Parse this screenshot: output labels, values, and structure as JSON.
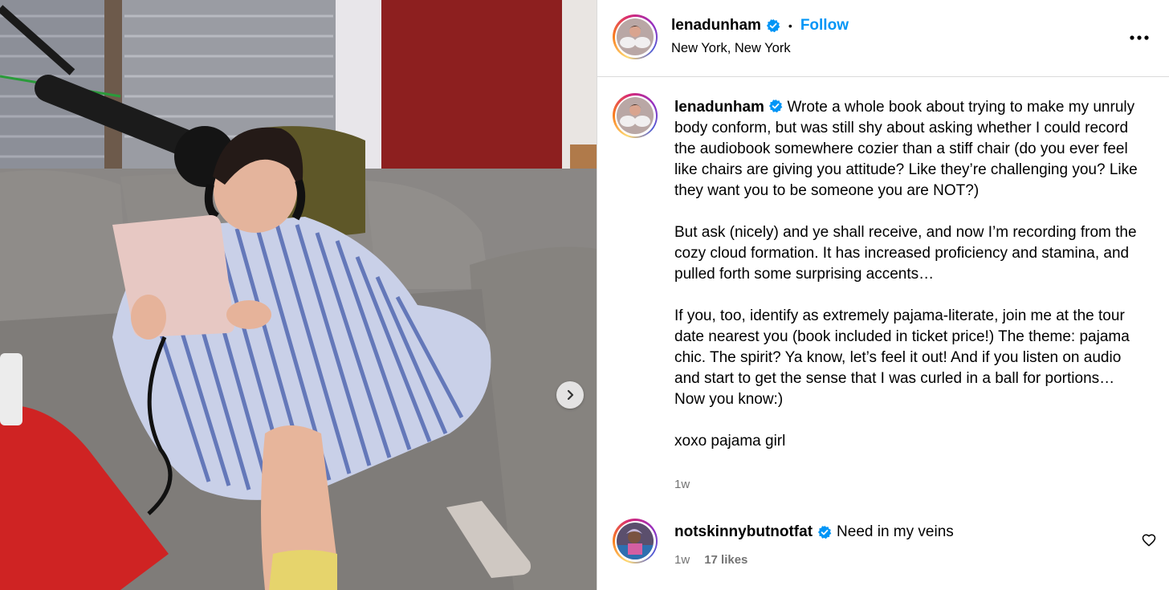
{
  "post": {
    "author": {
      "username": "lenadunham",
      "verified": true,
      "location": "New York, New York"
    },
    "header": {
      "separator": "•",
      "follow_label": "Follow",
      "more_label": "•••"
    },
    "caption": {
      "paragraphs": [
        "Wrote a whole book about trying to make my unruly body conform, but was still shy about asking whether I could record the audiobook somewhere cozier than a stiff chair (do you ever feel like chairs are giving you attitude? Like they’re challenging you? Like they want you to be someone you are NOT?)",
        "But ask (nicely) and ye shall receive, and now I’m recording from the cozy cloud formation. It has increased proficiency and stamina, and pulled forth some surprising accents…",
        "If you, too, identify as extremely pajama-literate, join me at the tour date nearest you (book included in ticket price!) The theme: pajama chic. The spirit? Ya know, let’s feel it out! And if you listen on audio and start to get the sense that I was curled in a ball for portions… Now you know:)",
        "xoxo pajama girl"
      ],
      "time": "1w"
    },
    "comments": [
      {
        "username": "notskinnybutnotfat",
        "verified": true,
        "text": "Need in my veins",
        "time": "1w",
        "likes": "17 likes"
      }
    ]
  },
  "icons": {
    "verified": "verified-badge-icon",
    "next": "chevron-right-icon",
    "like": "heart-icon",
    "more": "more-options-icon"
  },
  "colors": {
    "accent": "#0095f6",
    "muted": "#737373",
    "verified": "#0095f6",
    "divider": "#dbdbdb"
  }
}
